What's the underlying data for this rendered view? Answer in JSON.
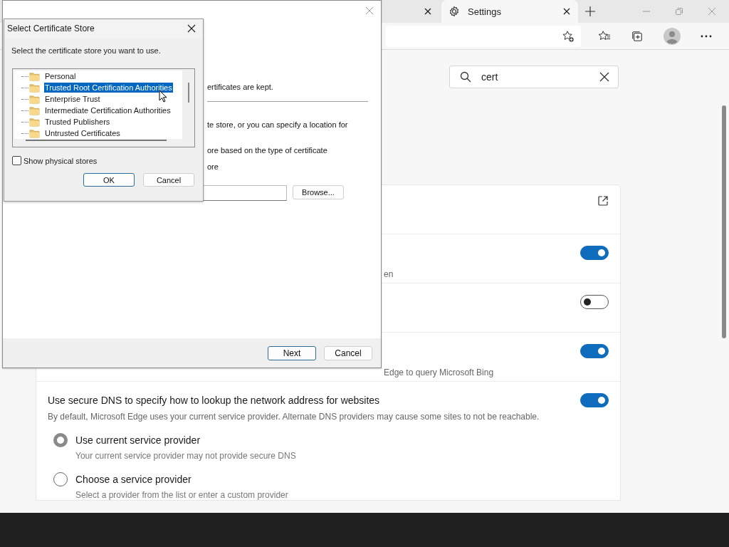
{
  "browser": {
    "tabs": [
      {
        "selected": false
      },
      {
        "label": "Settings",
        "selected": true
      }
    ],
    "search": {
      "value": "cert"
    },
    "settings_rows": [
      {
        "kind": "link"
      },
      {
        "kind": "toggle",
        "on": true,
        "description": "en"
      },
      {
        "kind": "toggle",
        "on": false
      },
      {
        "kind": "toggle",
        "on": true,
        "description": "Edge to query Microsoft Bing"
      }
    ],
    "dns": {
      "title": "Use secure DNS to specify how to lookup the network address for websites",
      "description": "By default, Microsoft Edge uses your current service provider. Alternate DNS providers may cause some sites to not be reachable.",
      "on": true,
      "options": [
        {
          "label": "Use current service provider",
          "description": "Your current service provider may not provide secure DNS",
          "selected": true
        },
        {
          "label": "Choose a service provider",
          "description": "Select a provider from the list or enter a custom provider",
          "selected": false
        }
      ]
    }
  },
  "wizard": {
    "lines": [
      "ertificates are kept.",
      "te store, or you can specify a location for",
      "ore based on the type of certificate",
      "ore"
    ],
    "browse_button": "Browse...",
    "buttons": [
      "Next",
      "Cancel"
    ]
  },
  "store_dialog": {
    "title": "Select Certificate Store",
    "prompt": "Select the certificate store you want to use.",
    "stores": [
      {
        "label": "Personal",
        "selected": false
      },
      {
        "label": "Trusted Root Certification Authorities",
        "selected": true
      },
      {
        "label": "Enterprise Trust",
        "selected": false
      },
      {
        "label": "Intermediate Certification Authorities",
        "selected": false
      },
      {
        "label": "Trusted Publishers",
        "selected": false
      },
      {
        "label": "Untrusted Certificates",
        "selected": false
      }
    ],
    "show_physical_stores": {
      "label": "Show physical stores",
      "checked": false
    },
    "buttons": [
      "OK",
      "Cancel"
    ]
  }
}
